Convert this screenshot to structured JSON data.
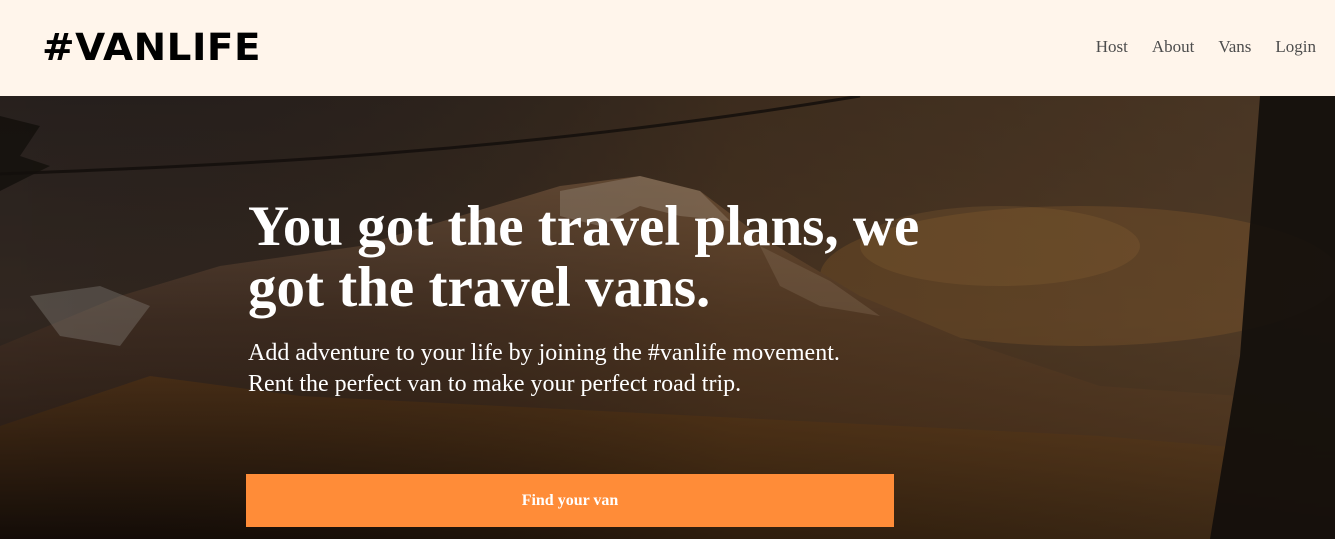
{
  "brand": {
    "logo_text": "#VANLIFE"
  },
  "nav": {
    "items": [
      {
        "label": "Host"
      },
      {
        "label": "About"
      },
      {
        "label": "Vans"
      },
      {
        "label": "Login"
      }
    ]
  },
  "hero": {
    "headline": "You got the travel plans, we got the travel vans.",
    "subtext_line1": "Add adventure to your life by joining the #vanlife movement.",
    "subtext_line2": "Rent the perfect van to make your perfect road trip.",
    "cta_label": "Find your van",
    "background_image": "mountain-landscape-photo"
  },
  "colors": {
    "header_bg": "#FFF5EB",
    "cta_bg": "#FF8C38",
    "nav_text": "#4D4D4D",
    "hero_text": "#FFFFFF"
  }
}
